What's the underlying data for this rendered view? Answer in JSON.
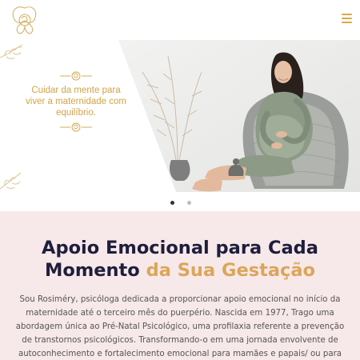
{
  "colors": {
    "gold": "#d2a347",
    "navy": "#1e1e3c",
    "pink_section": "#f7e8e9",
    "accent_title": "#dba65a"
  },
  "header": {
    "logo_icon": "butterfly-logo-icon",
    "menu_icon": "hamburger-menu-icon"
  },
  "hero": {
    "tagline": "Cuidar da mente para viver a maternidade com equilíbrio.",
    "photo": "pregnant-woman-in-armchair-photo",
    "slides_total": 2,
    "active_slide": 1
  },
  "about": {
    "title_main": "Apoio Emocional para Cada Momento",
    "title_accent": "da Sua Gestação",
    "description": "Sou Rosiméry, psicóloga dedicada a proporcionar apoio emocional no início da maternidade até o terceiro mês do puerpério. Nascida em 1977, Trago uma abordagem única ao Pré-Natal Psicológico, uma profilaxia referente a prevenção de transtornos psicológicos. Transformando-o em uma jornada envolvente de autoconhecimento e fortalecimento emocional para mamães e papais/ ou para futuro pais."
  }
}
